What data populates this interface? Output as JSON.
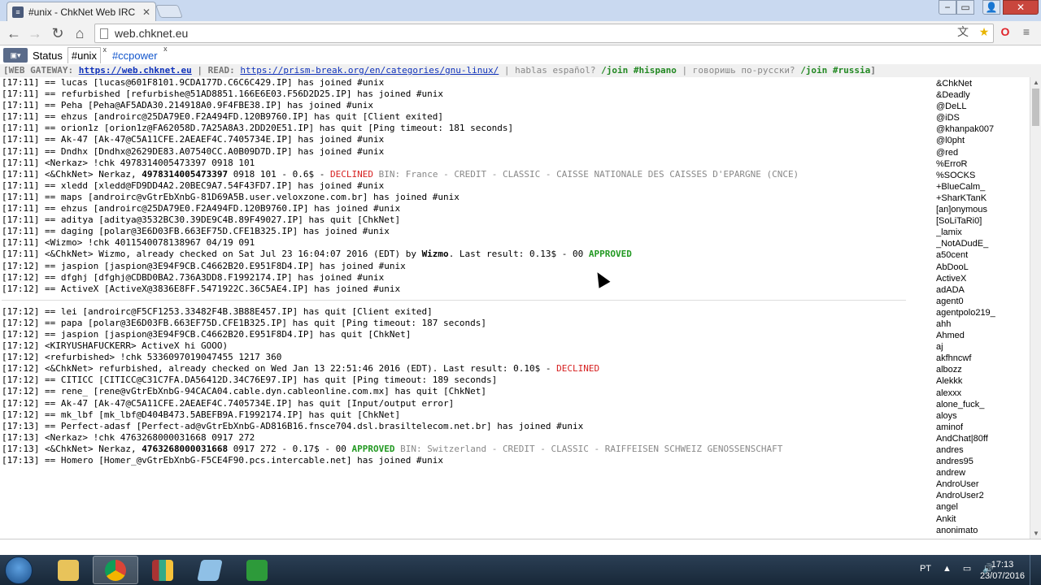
{
  "browser": {
    "tab_title": "#unix - ChkNet Web IRC",
    "url": "web.chknet.eu"
  },
  "irc_tabs": [
    {
      "label": "Status"
    },
    {
      "label": "#unix"
    },
    {
      "label": "#ccpower"
    }
  ],
  "topic": {
    "p1": "[WEB GATEWAY:",
    "link1": "https://web.chknet.eu",
    "p2": "| READ:",
    "link2": "https://prism-break.org/en/categories/gnu-linux/",
    "p3": "| hablas español?",
    "join1": "/join #hispano",
    "p4": "| говоришь по-русски?",
    "join2": "/join #russia",
    "p5": "]"
  },
  "chat": {
    "l1": "[17:11] == lucas [lucas@601F8101.9CDA177D.C6C6C429.IP] has joined #unix",
    "l2": "[17:11] == refurbished [refurbishe@51AD8851.166E6E03.F56D2D25.IP] has joined #unix",
    "l3": "[17:11] == Peha [Peha@AF5ADA30.214918A0.9F4FBE38.IP] has joined #unix",
    "l4": "[17:11] == ehzus [androirc@25DA79E0.F2A494FD.120B9760.IP] has quit [Client exited]",
    "l5": "[17:11] == orion1z [orion1z@FA62058D.7A25A8A3.2DD20E51.IP] has quit [Ping timeout: 181 seconds]",
    "l6": "[17:11] == Ak-47 [Ak-47@C5A11CFE.2AEAEF4C.7405734E.IP] has joined #unix",
    "l7": "[17:11] == Dndhx [Dndhx@2629DE83.A07540CC.A0B09D7D.IP] has joined #unix",
    "l8": "[17:11] <Nerkaz> !chk 4978314005473397 0918 101",
    "l9_a": "[17:11] <&ChkNet> Nerkaz,",
    "l9_b": "4978314005473397",
    "l9_c": "0918 101 - 0.6$ -",
    "l9_d": "DECLINED",
    "l9_e": "BIN: France - CREDIT - CLASSIC - CAISSE NATIONALE DES CAISSES D'EPARGNE (CNCE)",
    "l10": "[17:11] == xledd [xledd@FD9DD4A2.20BEC9A7.54F43FD7.IP] has joined #unix",
    "l11": "[17:11] == maps [androirc@vGtrEbXnbG-81D69A5B.user.veloxzone.com.br] has joined #unix",
    "l12": "[17:11] == ehzus [androirc@25DA79E0.F2A494FD.120B9760.IP] has joined #unix",
    "l13": "[17:11] == aditya [aditya@3532BC30.39DE9C4B.89F49027.IP] has quit [ChkNet]",
    "l14": "[17:11] == daging [polar@3E6D03FB.663EF75D.CFE1B325.IP] has joined #unix",
    "l15": "[17:11] <Wizmo> !chk 4011540078138967 04/19 091",
    "l16_a": "[17:11] <&ChkNet> Wizmo, already checked on Sat Jul 23 16:04:07 2016 (EDT) by",
    "l16_b": "Wizmo",
    "l16_c": ". Last result: 0.13$ - 00",
    "l16_d": "APPROVED",
    "l17": "[17:12] == jaspion [jaspion@3E94F9CB.C4662B20.E951F8D4.IP] has joined #unix",
    "l18": "[17:12] == dfghj [dfghj@CDBD0BA2.736A3DD8.F1992174.IP] has joined #unix",
    "l19": "[17:12] == ActiveX [ActiveX@3836E8FF.5471922C.36C5AE4.IP] has joined #unix",
    "l20": "[17:12] == lei [androirc@F5CF1253.33482F4B.3B88E457.IP] has quit [Client exited]",
    "l21": "[17:12] == papa [polar@3E6D03FB.663EF75D.CFE1B325.IP] has quit [Ping timeout: 187 seconds]",
    "l22": "[17:12] == jaspion [jaspion@3E94F9CB.C4662B20.E951F8D4.IP] has quit [ChkNet]",
    "l23": "[17:12] <KIRYUSHAFUCKERR> ActiveX hi GOOO)",
    "l24": "[17:12] <refurbished> !chk 5336097019047455 1217 360",
    "l25_a": "[17:12] <&ChkNet> refurbished, already checked on Wed Jan 13 22:51:46 2016 (EDT). Last result: 0.10$ -",
    "l25_b": "DECLINED",
    "l26": "[17:12] == CITICC [CITICC@C31C7FA.DA56412D.34C76E97.IP] has quit [Ping timeout: 189 seconds]",
    "l27": "[17:12] == rene_ [rene@vGtrEbXnbG-94CACA04.cable.dyn.cableonline.com.mx] has quit [ChkNet]",
    "l28": "[17:12] == Ak-47 [Ak-47@C5A11CFE.2AEAEF4C.7405734E.IP] has quit [Input/output error]",
    "l29": "[17:12] == mk_lbf [mk_lbf@D404B473.5ABEFB9A.F1992174.IP] has quit [ChkNet]",
    "l30": "[17:13] == Perfect-adasf [Perfect-ad@vGtrEbXnbG-AD816B16.fnsce704.dsl.brasiltelecom.net.br] has joined #unix",
    "l31": "[17:13] <Nerkaz> !chk 4763268000031668 0917 272",
    "l32_a": "[17:13] <&ChkNet> Nerkaz,",
    "l32_b": "4763268000031668",
    "l32_c": "0917 272 - 0.17$ - 00",
    "l32_d": "APPROVED",
    "l32_e": "BIN: Switzerland - CREDIT - CLASSIC - RAIFFEISEN SCHWEIZ GENOSSENSCHAFT",
    "l33": "[17:13] == Homero [Homer_@vGtrEbXnbG-F5CE4F90.pcs.intercable.net] has joined #unix"
  },
  "nicks": [
    "&ChkNet",
    "&Deadly",
    "@DeLL",
    "@iDS",
    "@khanpak007",
    "@l0pht",
    "@red",
    "%ErroR",
    "%SOCKS",
    "+BlueCalm_",
    "+SharKTanK",
    "[an]onymous",
    "[SoLiTaRi0]",
    "_lamix",
    "_NotADudE_",
    "a50cent",
    "AbDooL",
    "ActiveX",
    "adADA",
    "agent0",
    "agentpolo219_",
    "ahh",
    "Ahmed",
    "aj",
    "akfhncwf",
    "albozz",
    "Alekkk",
    "alexxx",
    "alone_fuck_",
    "aloys",
    "aminof",
    "AndChat|80ff",
    "andres",
    "andres95",
    "andrew",
    "AndroUser",
    "AndroUser2",
    "angel",
    "Ankit",
    "anonimato"
  ],
  "taskbar": {
    "lang": "PT",
    "time": "17:13",
    "date": "23/07/2016"
  }
}
